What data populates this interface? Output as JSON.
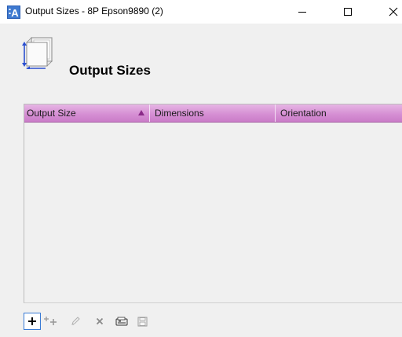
{
  "window": {
    "title": "Output Sizes - 8P Epson9890 (2)",
    "app_icon": "app-logo-icon",
    "controls": [
      "minimize-icon",
      "maximize-icon",
      "close-icon"
    ]
  },
  "header": {
    "title": "Output Sizes",
    "icon": "output-size-icon"
  },
  "table": {
    "columns": [
      {
        "label": "Output Size",
        "sorted": "ascending"
      },
      {
        "label": "Dimensions"
      },
      {
        "label": "Orientation"
      }
    ],
    "rows": []
  },
  "toolbar": {
    "buttons": [
      {
        "icon": "add-icon",
        "enabled": true,
        "focused": true
      },
      {
        "icon": "add-multiple-icon",
        "enabled": false
      },
      {
        "icon": "edit-icon",
        "enabled": false
      },
      {
        "icon": "delete-icon",
        "enabled": false
      },
      {
        "icon": "import-icon",
        "enabled": true
      },
      {
        "icon": "save-icon",
        "enabled": false
      }
    ]
  },
  "colors": {
    "header_gradient_top": "#e6b4e4",
    "header_gradient_bottom": "#ca7cc8",
    "sort_arrow": "#8a2a88",
    "focus_border": "#3a7bd5"
  }
}
